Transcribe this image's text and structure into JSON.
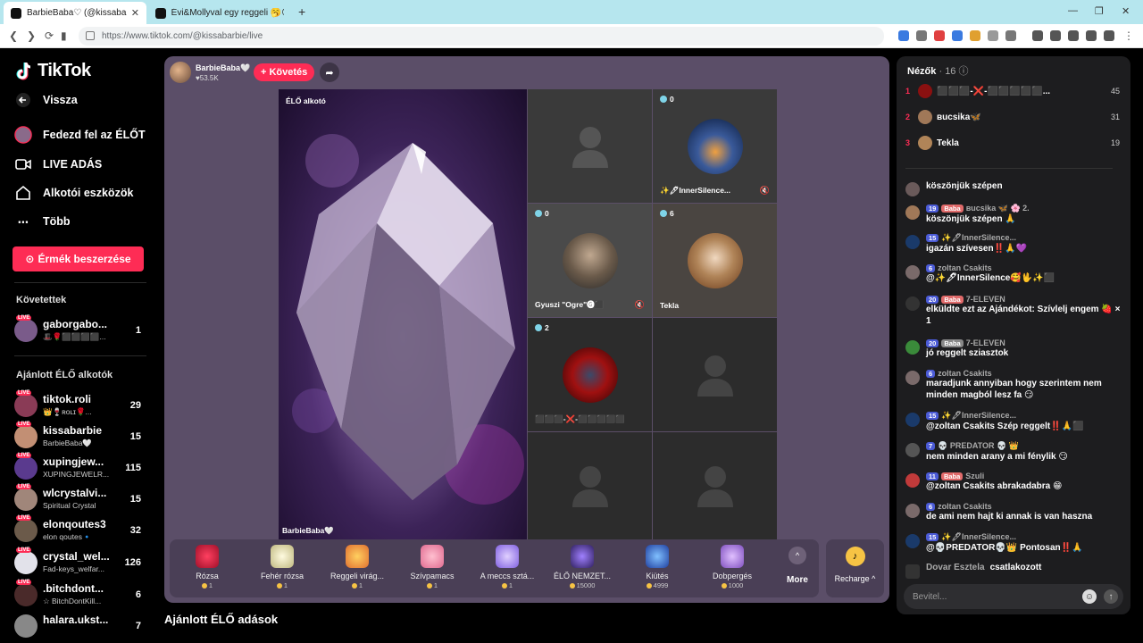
{
  "browser": {
    "tabs": [
      {
        "title": "BarbieBaba♡ (@kissabarbie",
        "active": true
      },
      {
        "title": "Évi&Mollyval egy reggeli 🥱😪 (@m",
        "active": false
      }
    ],
    "new_tab": "+",
    "url": "https://www.tiktok.com/@kissabarbie/live"
  },
  "sidebar": {
    "logo": "TikTok",
    "nav": [
      {
        "label": "Vissza",
        "icon": "back-arrow-icon"
      },
      {
        "label": "Fedezd fel az ÉLŐT",
        "icon": "avatar-icon"
      },
      {
        "label": "LIVE ADÁS",
        "icon": "camera-icon"
      },
      {
        "label": "Alkotói eszközök",
        "icon": "home-icon"
      },
      {
        "label": "Több",
        "icon": "more-dots-icon"
      }
    ],
    "coins_button": "Érmék beszerzése",
    "following_title": "Követettek",
    "following": [
      {
        "name": "gaborgabo...",
        "sub": "🎩🌹⬛⬛⬛⬛...",
        "count": "1",
        "color": "#7a5b8a"
      }
    ],
    "recommended_title": "Ajánlott ÉLŐ alkotók",
    "recommended": [
      {
        "name": "tiktok.roli",
        "sub": "👑🍷ʀᴏʟɪ🌹...",
        "count": "29",
        "color": "#8a3b56"
      },
      {
        "name": "kissabarbie",
        "sub": "BarbieBaba🤍",
        "count": "15",
        "color": "#c28f74"
      },
      {
        "name": "xupingjew...",
        "sub": "XUPINGJEWELR...",
        "count": "115",
        "color": "#5a3a8e"
      },
      {
        "name": "wlcrystalvi...",
        "sub": "Spiritual Crystal",
        "count": "15",
        "color": "#a0867a"
      },
      {
        "name": "elonqoutes3",
        "sub": "elon qoutes🔹",
        "count": "32",
        "color": "#6b5a4a"
      },
      {
        "name": "crystal_wel...",
        "sub": "Fad-keys_welfar...",
        "count": "126",
        "color": "#e2e2ea"
      },
      {
        "name": ".bitchdont...",
        "sub": "☆ BitchDontKill...",
        "count": "6",
        "color": "#4a2a2a"
      },
      {
        "name": "halara.ukst...",
        "sub": "",
        "count": "7",
        "color": "#888"
      }
    ]
  },
  "stage": {
    "host_name": "BarbieBaba🤍",
    "host_likes": "♥53.5K",
    "follow_label": "+ Követés",
    "main_label": "ÉLŐ alkotó",
    "main_owner": "BarbieBaba🤍",
    "guests": [
      {
        "num": "",
        "name": "",
        "placeholder": true
      },
      {
        "num": "0",
        "name": "✨🖊InnerSilence...",
        "placeholder": false,
        "color": "#1a3a6a",
        "muted": true
      },
      {
        "num": "0",
        "name": "Gyuszi \"Ogre\"🅖⬛",
        "placeholder": false,
        "color": "#8a8070",
        "muted": true
      },
      {
        "num": "6",
        "name": "Tekla",
        "placeholder": false,
        "color": "#b08458",
        "muted": false
      },
      {
        "num": "2",
        "name": "⬛⬛⬛-❌-⬛⬛⬛⬛⬛",
        "placeholder": false,
        "color": "#8a1010",
        "muted": false
      },
      {
        "num": "",
        "name": "",
        "placeholder": true
      },
      {
        "num": "",
        "name": "",
        "placeholder": true
      },
      {
        "num": "",
        "name": "",
        "placeholder": true
      }
    ],
    "gifts": [
      {
        "name": "Rózsa",
        "price": "1",
        "color": "#d0203a"
      },
      {
        "name": "Fehér rózsa",
        "price": "1",
        "color": "#e8e2c0"
      },
      {
        "name": "Reggeli virág...",
        "price": "1",
        "color": "#e8b030"
      },
      {
        "name": "Szívpamacs",
        "price": "1",
        "color": "#f08aa8"
      },
      {
        "name": "A meccs sztá...",
        "price": "1",
        "color": "#b080e0"
      },
      {
        "name": "ÉLŐ NEMZET...",
        "price": "15000",
        "color": "#6040a0"
      },
      {
        "name": "Kiütés",
        "price": "4999",
        "color": "#3a6ad0"
      },
      {
        "name": "Dobpergés",
        "price": "1000",
        "color": "#a070d0"
      }
    ],
    "more_label": "More",
    "recharge_label": "Recharge ^"
  },
  "bottom_heading": "Ajánlott ÉLŐ adások",
  "chat": {
    "viewers_label": "Nézők",
    "viewers_count": "· 16",
    "ranking": [
      {
        "rank": "1",
        "name": "⬛⬛⬛-❌-⬛⬛⬛⬛⬛...",
        "score": "45",
        "color": "#8a1010"
      },
      {
        "rank": "2",
        "name": "ʙucsika🦋",
        "score": "31",
        "color": "#a07858"
      },
      {
        "rank": "3",
        "name": "Tekla",
        "score": "19",
        "color": "#b08458"
      }
    ],
    "messages": [
      {
        "badges": [],
        "user": "",
        "text": "köszönjük szépen",
        "color": "#6a5a5a"
      },
      {
        "badges": [
          "19",
          "Baba"
        ],
        "user": "ʙucsika 🦋 🌸 2.",
        "text": "köszönjük szépen 🙏",
        "color": "#a07858"
      },
      {
        "badges": [
          "15"
        ],
        "user": "✨🖊InnerSilence...",
        "text": "igazán szívesen‼️🙏💜",
        "color": "#1a3a6a"
      },
      {
        "badges": [
          "6"
        ],
        "user": "zoltan Csakits",
        "text": "@✨🖊InnerSilence🥰🖖✨⬛",
        "color": "#7a6a6a"
      },
      {
        "badges": [
          "20",
          "Baba"
        ],
        "user": "7-ELEVEN",
        "text": "elküldte ezt az Ajándékot: Szívlelj engem 🍓 × 1",
        "color": "#333"
      },
      {
        "badges": [
          "20",
          "Baba"
        ],
        "user": "7-ELEVEN",
        "text": "jó reggelt sziasztok",
        "color": "#3a8a3a"
      },
      {
        "badges": [
          "6"
        ],
        "user": "zoltan Csakits",
        "text": "maradjunk annyiban hogy szerintem nem minden magból lesz fa 😏",
        "color": "#7a6a6a"
      },
      {
        "badges": [
          "15"
        ],
        "user": "✨🖊InnerSilence...",
        "text": "@zoltan Csakits Szép reggelt‼️🙏⬛",
        "color": "#1a3a6a"
      },
      {
        "badges": [
          "7"
        ],
        "user": "💀 PREDATOR 💀 👑",
        "text": "nem minden arany a mi fénylik 😏",
        "color": "#555"
      },
      {
        "badges": [
          "11",
          "Baba"
        ],
        "user": "Szuli",
        "text": "@zoltan Csakits abrakadabra 😁",
        "color": "#c03a3a"
      },
      {
        "badges": [
          "6"
        ],
        "user": "zoltan Csakits",
        "text": "de ami nem hajt ki annak is van haszna",
        "color": "#7a6a6a"
      },
      {
        "badges": [
          "15"
        ],
        "user": "✨🖊InnerSilence...",
        "text": "@💀PREDATOR💀👑 Pontosan‼️🙏",
        "color": "#1a3a6a"
      }
    ],
    "join": {
      "user": "Dovar Esztela",
      "text": "csatlakozott"
    },
    "input_placeholder": "Bevitel..."
  }
}
